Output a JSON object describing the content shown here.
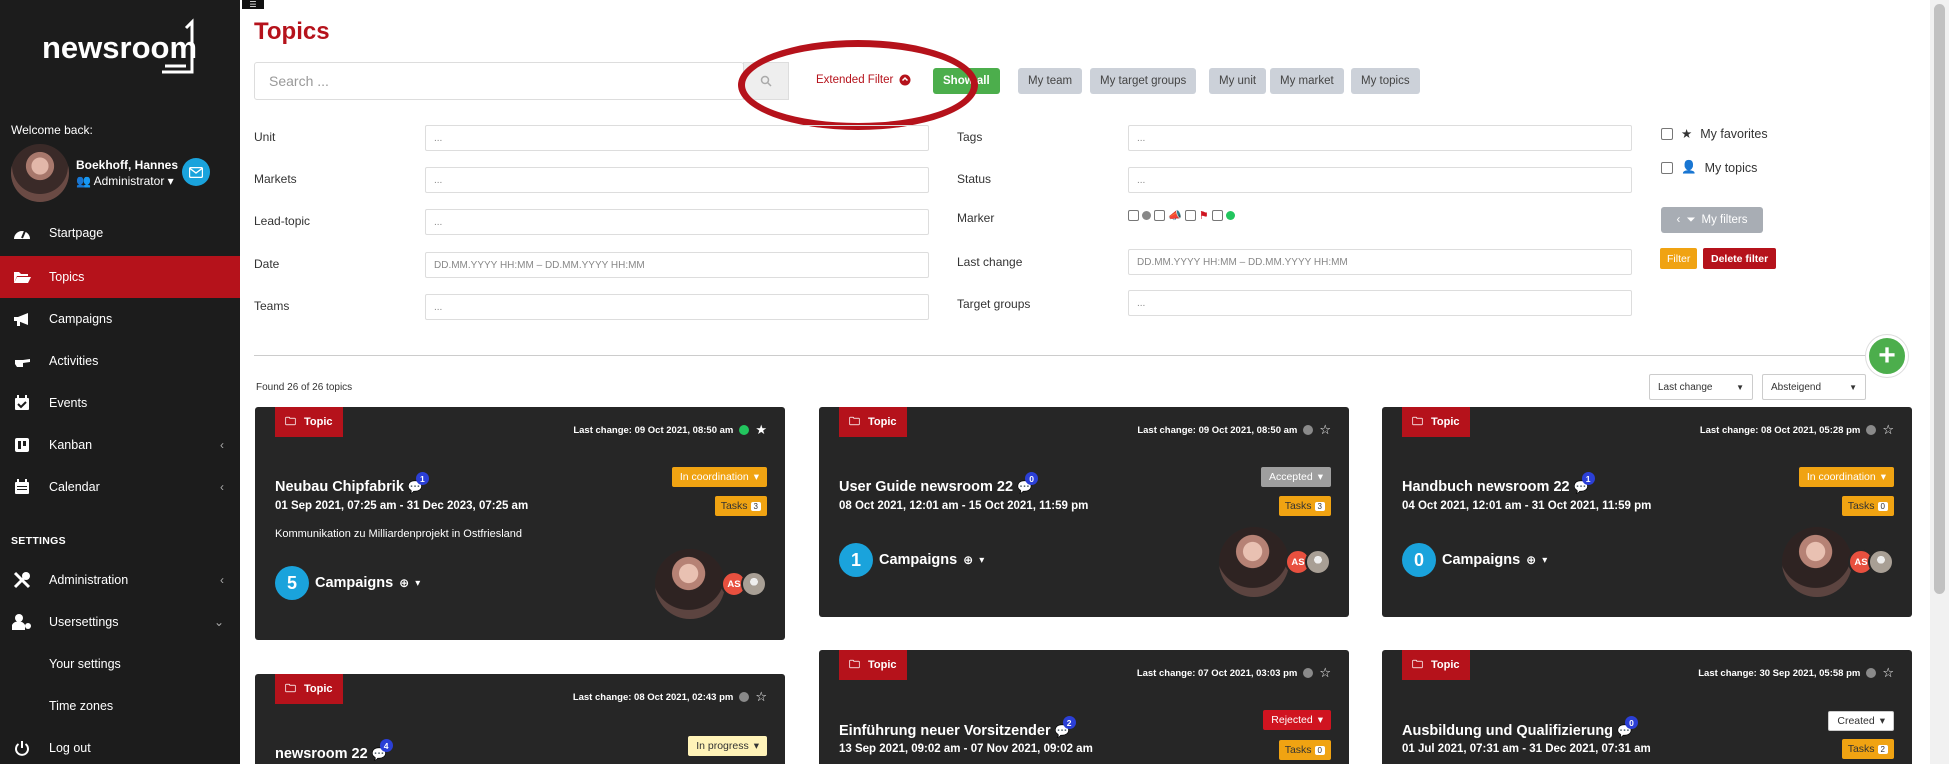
{
  "app": {
    "logo_text": "newsroom",
    "logo_mark": "1",
    "brand_color": "#b5121b"
  },
  "user": {
    "welcome": "Welcome back:",
    "name": "Boekhoff, Hannes",
    "role": "Administrator"
  },
  "nav": {
    "items": [
      {
        "label": "Startpage",
        "icon": "dashboard-icon"
      },
      {
        "label": "Topics",
        "icon": "folder-open-icon",
        "active": true
      },
      {
        "label": "Campaigns",
        "icon": "megaphone-icon"
      },
      {
        "label": "Activities",
        "icon": "hand-point-icon"
      },
      {
        "label": "Events",
        "icon": "calendar-check-icon"
      },
      {
        "label": "Kanban",
        "icon": "kanban-icon",
        "chevron": "‹"
      },
      {
        "label": "Calendar",
        "icon": "calendar-icon",
        "chevron": "‹"
      }
    ],
    "settings_header": "SETTINGS",
    "settings_items": [
      {
        "label": "Administration",
        "icon": "tools-icon",
        "chevron": "‹"
      },
      {
        "label": "Usersettings",
        "icon": "user-cog-icon",
        "chevron": "⌄"
      },
      {
        "label": "Your settings"
      },
      {
        "label": "Time zones"
      },
      {
        "label": "Log out",
        "icon": "power-icon"
      }
    ]
  },
  "page": {
    "title": "Topics"
  },
  "search": {
    "placeholder": "Search ...",
    "extended_filter": "Extended Filter",
    "show_all": "Show all"
  },
  "quick_filters": [
    "My team",
    "My target groups",
    "My unit",
    "My market",
    "My topics"
  ],
  "filters": {
    "left": [
      {
        "label": "Unit",
        "placeholder": "..."
      },
      {
        "label": "Markets",
        "placeholder": "..."
      },
      {
        "label": "Lead-topic",
        "placeholder": "..."
      },
      {
        "label": "Date",
        "placeholder": "DD.MM.YYYY HH:MM – DD.MM.YYYY HH:MM"
      },
      {
        "label": "Teams",
        "placeholder": "..."
      }
    ],
    "right": [
      {
        "label": "Tags",
        "placeholder": "..."
      },
      {
        "label": "Status",
        "placeholder": "..."
      },
      {
        "label": "Marker",
        "placeholder": ""
      },
      {
        "label": "Last change",
        "placeholder": "DD.MM.YYYY HH:MM – DD.MM.YYYY HH:MM"
      },
      {
        "label": "Target groups",
        "placeholder": "..."
      }
    ],
    "favorites": "My favorites",
    "my_topics": "My topics",
    "my_filters": "My filters",
    "filter_btn": "Filter",
    "delete_filter": "Delete filter"
  },
  "results": {
    "found": "Found 26 of 26 topics",
    "sort_by": "Last change",
    "order": "Absteigend"
  },
  "cards": [
    {
      "tag": "Topic",
      "last_change": "Last change: 09 Oct 2021, 08:50 am",
      "dot": "#22c55e",
      "star": "★",
      "title": "Neubau Chipfabrik",
      "comments": "1",
      "dates": "01 Sep 2021, 07:25 am - 31 Dec 2023, 07:25 am",
      "desc": "Kommunikation zu Milliardenprojekt in Ostfriesland",
      "status": "In coordination",
      "tasks": "Tasks",
      "tasks_count": "3",
      "campaigns_count": "5",
      "campaigns_label": "Campaigns",
      "initials": "AS"
    },
    {
      "tag": "Topic",
      "last_change": "Last change: 09 Oct 2021, 08:50 am",
      "dot": "#8a8a8a",
      "star": "☆",
      "title": "User Guide newsroom 22",
      "comments": "0",
      "dates": "08 Oct 2021, 12:01 am - 15 Oct 2021, 11:59 pm",
      "desc": "",
      "status": "Accepted",
      "tasks": "Tasks",
      "tasks_count": "3",
      "campaigns_count": "1",
      "campaigns_label": "Campaigns",
      "initials": "AS"
    },
    {
      "tag": "Topic",
      "last_change": "Last change: 08 Oct 2021, 05:28 pm",
      "dot": "#8a8a8a",
      "star": "☆",
      "title": "Handbuch newsroom 22",
      "comments": "1",
      "dates": "04 Oct 2021, 12:01 am - 31 Oct 2021, 11:59 pm",
      "desc": "",
      "status": "In coordination",
      "tasks": "Tasks",
      "tasks_count": "0",
      "campaigns_count": "0",
      "campaigns_label": "Campaigns",
      "initials": "AS"
    },
    {
      "tag": "Topic",
      "last_change": "Last change: 08 Oct 2021, 02:43 pm",
      "dot": "#8a8a8a",
      "star": "☆",
      "title": "newsroom 22",
      "comments": "4",
      "status": "In progress"
    },
    {
      "tag": "Topic",
      "last_change": "Last change: 07 Oct 2021, 03:03 pm",
      "dot": "#8a8a8a",
      "star": "☆",
      "title": "Einführung neuer Vorsitzender",
      "comments": "2",
      "dates": "13 Sep 2021, 09:02 am - 07 Nov 2021, 09:02 am",
      "status": "Rejected",
      "tasks": "Tasks",
      "tasks_count": "0"
    },
    {
      "tag": "Topic",
      "last_change": "Last change: 30 Sep 2021, 05:58 pm",
      "dot": "#8a8a8a",
      "star": "☆",
      "title": "Ausbildung und Qualifizierung",
      "comments": "0",
      "dates": "01 Jul 2021, 07:31 am - 31 Dec 2021, 07:31 am",
      "status": "Created",
      "tasks": "Tasks",
      "tasks_count": "2"
    }
  ]
}
